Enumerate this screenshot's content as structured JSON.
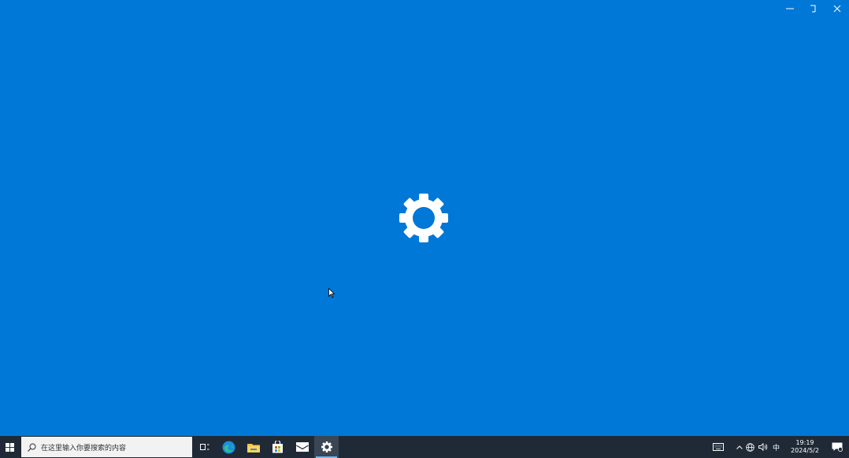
{
  "window": {
    "background_color": "#0078d7",
    "controls": {
      "minimize_icon": "minimize-icon",
      "restore_icon": "restore-icon",
      "close_icon": "close-icon"
    },
    "splash_icon": "settings-gear-icon"
  },
  "taskbar": {
    "background_color": "#1f2a36",
    "search": {
      "placeholder": "在这里输入你要搜索的内容"
    },
    "pinned": [
      {
        "name": "task-view",
        "icon": "task-view-icon"
      },
      {
        "name": "edge",
        "icon": "edge-icon"
      },
      {
        "name": "file-explorer",
        "icon": "folder-icon"
      },
      {
        "name": "store",
        "icon": "store-bag-icon"
      },
      {
        "name": "mail",
        "icon": "mail-icon"
      },
      {
        "name": "settings",
        "icon": "gear-icon",
        "active": true
      }
    ],
    "tray": {
      "ime_mode": "中",
      "time": "19:19",
      "date": "2024/5/2"
    }
  }
}
